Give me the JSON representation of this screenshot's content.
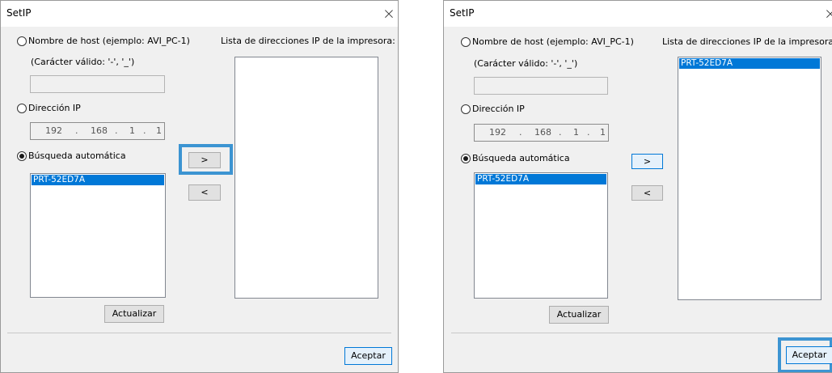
{
  "dialogs": [
    {
      "title": "SetIP",
      "close_glyph": "×",
      "hostname_label": "Nombre de host (ejemplo: AVI_PC-1)",
      "valid_chars_label": "(Carácter válido: '-', '_')",
      "hostname_value": "",
      "ip_label": "Dirección IP",
      "ip_octets": [
        "192",
        "168",
        "1",
        "1"
      ],
      "ip_separator": ".",
      "auto_label": "Búsqueda automática",
      "search_results": [
        "PRT-52ED7A"
      ],
      "add_button": ">",
      "remove_button": "<",
      "refresh_button": "Actualizar",
      "printer_list_label": "Lista de direcciones IP de la impresora:",
      "printer_list": [],
      "ok_button": "Aceptar",
      "selected_mode": "auto",
      "highlight": "add-button"
    },
    {
      "title": "SetIP",
      "close_glyph": "×",
      "hostname_label": "Nombre de host (ejemplo: AVI_PC-1)",
      "valid_chars_label": "(Carácter válido: '-', '_')",
      "hostname_value": "",
      "ip_label": "Dirección IP",
      "ip_octets": [
        "192",
        "168",
        "1",
        "1"
      ],
      "ip_separator": ".",
      "auto_label": "Búsqueda automática",
      "search_results": [
        "PRT-52ED7A"
      ],
      "add_button": ">",
      "remove_button": "<",
      "refresh_button": "Actualizar",
      "printer_list_label": "Lista de direcciones IP de la impresora:",
      "printer_list": [
        "PRT-52ED7A"
      ],
      "ok_button": "Aceptar",
      "selected_mode": "auto",
      "highlight": "ok-button"
    }
  ],
  "colors": {
    "highlight": "#3c94d2",
    "selection": "#0078d7",
    "dialog_bg": "#f0f0f0",
    "titlebar_bg": "#ffffff"
  }
}
